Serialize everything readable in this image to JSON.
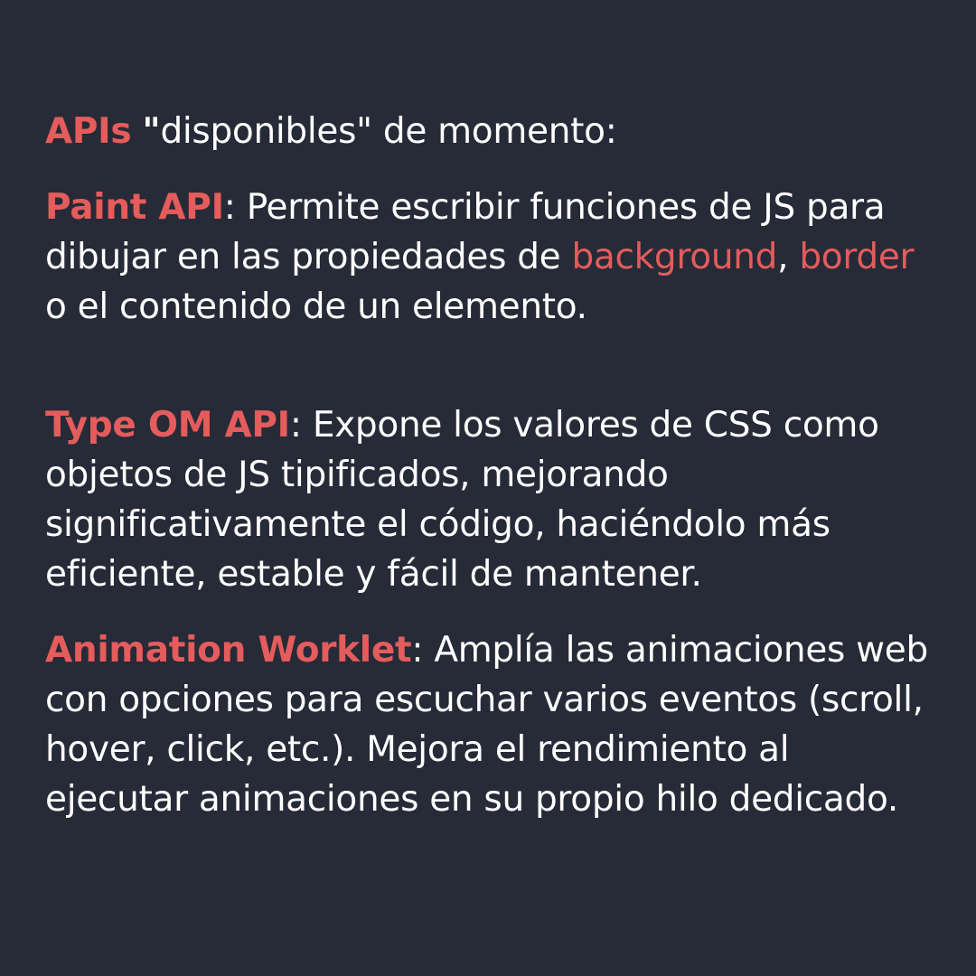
{
  "heading": {
    "apis": "APIs",
    "quote_open": "\"",
    "rest": "disponibles\" de momento:"
  },
  "paint": {
    "title": "Paint API",
    "sep": ": ",
    "text1": "Permite escribir funciones de JS para dibujar en las propiedades de ",
    "kw1": "background",
    "comma": ", ",
    "kw2": "border",
    "text2": " o el contenido de un elemento."
  },
  "typeom": {
    "title": "Type OM API",
    "sep": ": ",
    "text": "Expone los valores de CSS como objetos de JS tipificados, mejorando significativamente el código, haciéndolo más eficiente, estable y fácil de mantener."
  },
  "animation": {
    "title": "Animation Worklet",
    "sep": ": ",
    "text": "Amplía las animaciones web con opciones para escuchar varios eventos (scroll, hover, click, etc.). Mejora el rendimiento al ejecutar animaciones en su propio hilo dedicado."
  },
  "colors": {
    "background": "#272a37",
    "accent": "#e45c5c",
    "text": "#ffffff"
  }
}
